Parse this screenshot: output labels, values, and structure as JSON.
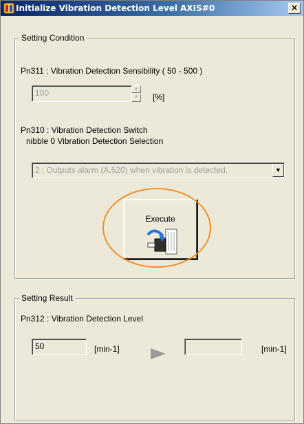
{
  "window": {
    "title": "Initialize Vibration Detection Level AXIS#0",
    "close_glyph": "×"
  },
  "setting_condition": {
    "legend": "Setting Condition",
    "pn311_label": "Pn311 : Vibration Detection Sensibility  ( 50 - 500 )",
    "pn311_value": "100",
    "pn311_unit": "[%]",
    "pn310_label": "Pn310 : Vibration Detection Switch",
    "pn310_sublabel": "nibble 0 Vibration Detection Selection",
    "pn310_selected": "2 : Outputs alarm (A.520) when vibration is detected."
  },
  "execute": {
    "label": "Execute"
  },
  "setting_result": {
    "legend": "Setting Result",
    "pn312_label": "Pn312 : Vibration Detection Level",
    "current_value": "50",
    "current_unit": "[min-1]",
    "new_value": "",
    "new_unit": "[min-1]"
  },
  "colors": {
    "highlight": "#f0902a",
    "title_bar": "#0a246a"
  },
  "icons": {
    "app": "app-alert-icon",
    "execute": "motor-vibration-icon",
    "arrow": "arrow-right-icon"
  }
}
